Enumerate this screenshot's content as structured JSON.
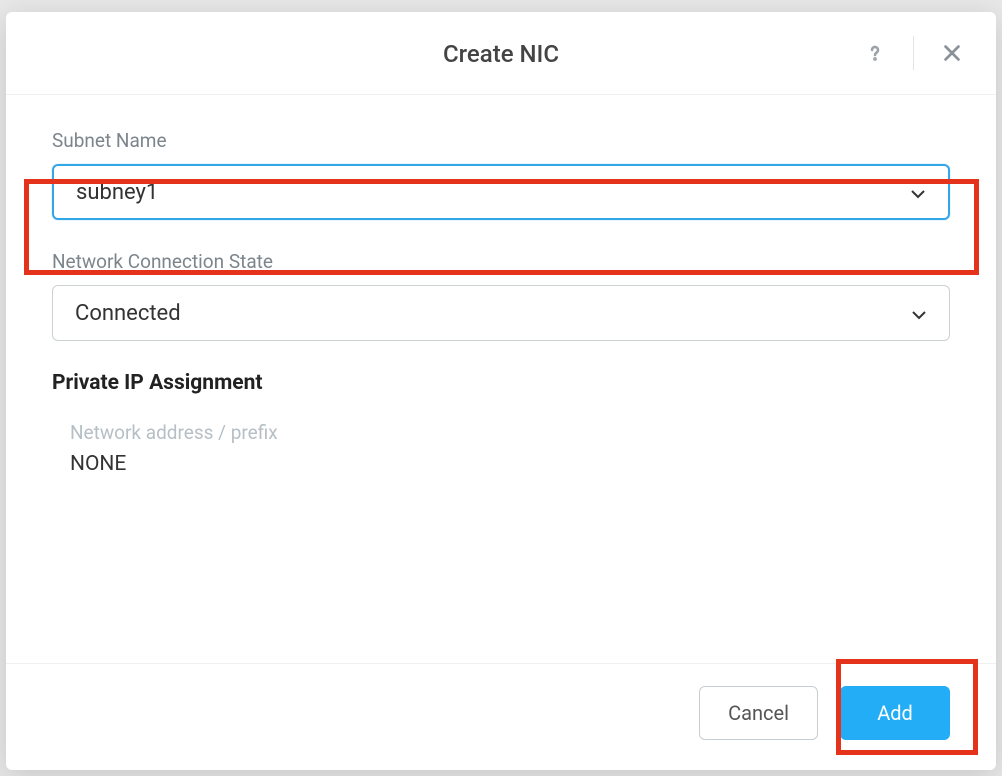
{
  "modal": {
    "title": "Create NIC",
    "fields": {
      "subnet_name": {
        "label": "Subnet Name",
        "value": "subney1"
      },
      "network_connection_state": {
        "label": "Network Connection State",
        "value": "Connected"
      }
    },
    "private_ip": {
      "heading": "Private IP Assignment",
      "address_label": "Network address / prefix",
      "address_value": "NONE"
    },
    "footer": {
      "cancel_label": "Cancel",
      "add_label": "Add"
    }
  }
}
